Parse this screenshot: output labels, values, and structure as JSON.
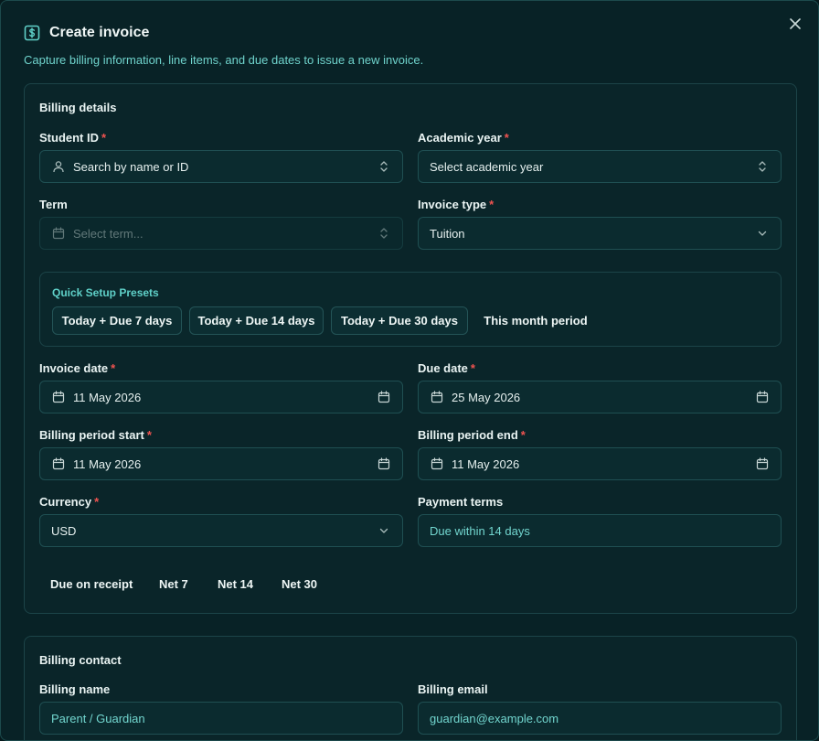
{
  "dialog": {
    "title": "Create invoice",
    "subtitle": "Capture billing information, line items, and due dates to issue a new invoice."
  },
  "billing_details": {
    "section_title": "Billing details",
    "student_id": {
      "label": "Student ID",
      "placeholder": "Search by name or ID"
    },
    "academic_year": {
      "label": "Academic year",
      "placeholder": "Select academic year"
    },
    "term": {
      "label": "Term",
      "placeholder": "Select term..."
    },
    "invoice_type": {
      "label": "Invoice type",
      "value": "Tuition"
    },
    "presets": {
      "title": "Quick Setup Presets",
      "items": [
        "Today + Due 7 days",
        "Today + Due 14 days",
        "Today + Due 30 days",
        "This month period"
      ]
    },
    "invoice_date": {
      "label": "Invoice date",
      "value": "11 May 2026"
    },
    "due_date": {
      "label": "Due date",
      "value": "25 May 2026"
    },
    "period_start": {
      "label": "Billing period start",
      "value": "11 May 2026"
    },
    "period_end": {
      "label": "Billing period end",
      "value": "11 May 2026"
    },
    "currency": {
      "label": "Currency",
      "value": "USD"
    },
    "payment_terms": {
      "label": "Payment terms",
      "value": "Due within 14 days"
    },
    "term_options": [
      "Due on receipt",
      "Net 7",
      "Net 14",
      "Net 30"
    ],
    "required_mark": "*"
  },
  "billing_contact": {
    "section_title": "Billing contact",
    "name": {
      "label": "Billing name",
      "value": "Parent / Guardian"
    },
    "email": {
      "label": "Billing email",
      "value": "guardian@example.com"
    }
  },
  "colors": {
    "background": "#082226",
    "accent": "#5fd0c8",
    "required": "#ef5350",
    "border": "#1f4f52"
  }
}
